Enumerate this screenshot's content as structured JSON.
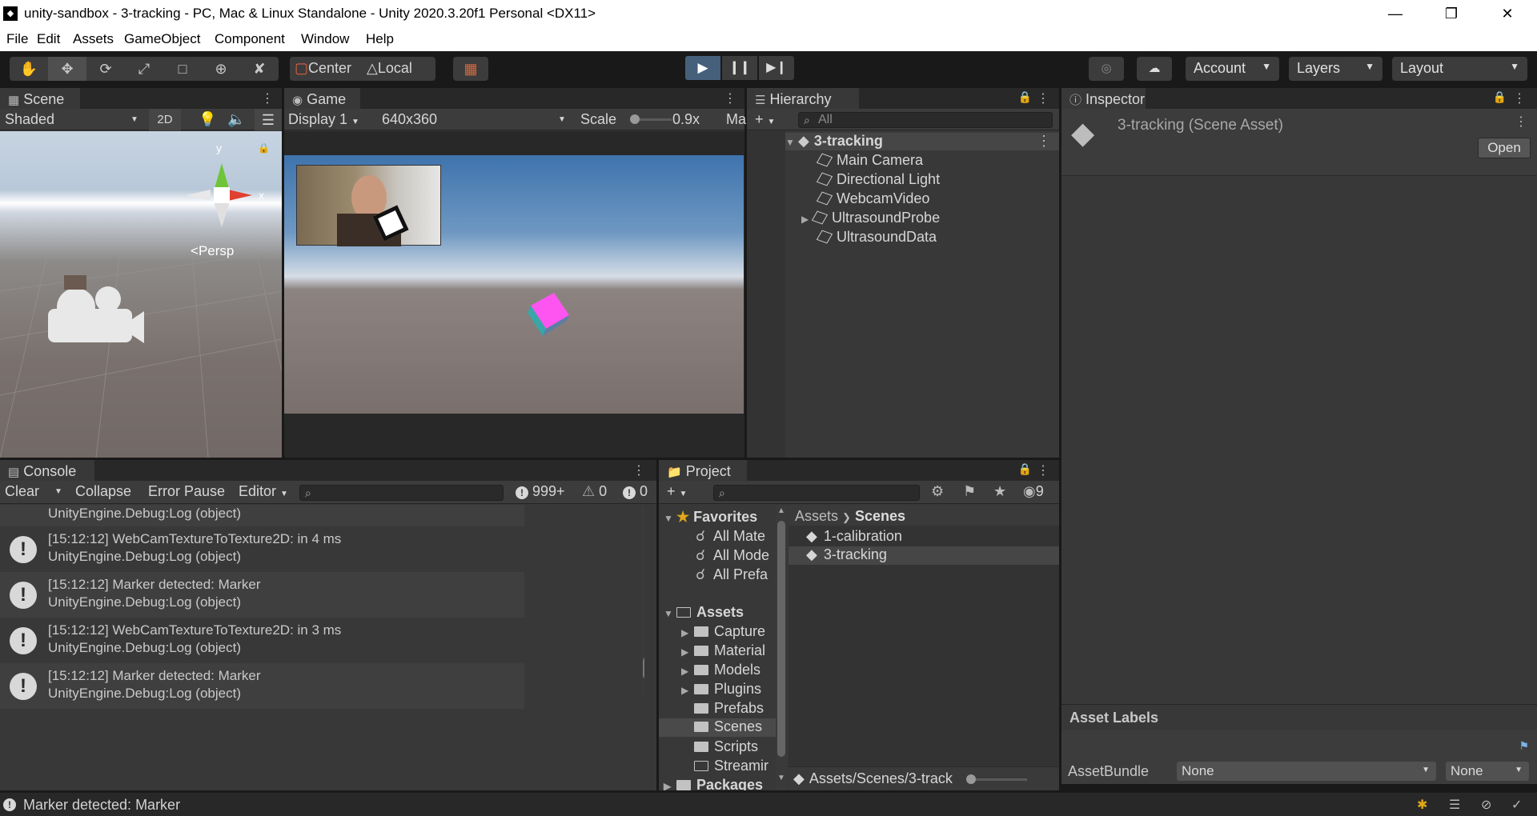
{
  "window": {
    "title": "unity-sandbox - 3-tracking - PC, Mac & Linux Standalone - Unity 2020.3.20f1 Personal <DX11>",
    "minimize": "—",
    "maximize": "❐",
    "close": "✕"
  },
  "menu": [
    "File",
    "Edit",
    "Assets",
    "GameObject",
    "Component",
    "Window",
    "Help"
  ],
  "toolbar": {
    "pivot": "Center",
    "space": "Local",
    "account": "Account",
    "layers": "Layers",
    "layout": "Layout"
  },
  "scene": {
    "tab": "Scene",
    "shading": "Shaded",
    "mode2d": "2D",
    "persp": "Persp",
    "axis_y": "y",
    "axis_x": "x"
  },
  "game": {
    "tab": "Game",
    "display": "Display 1",
    "resolution": "640x360",
    "scale_label": "Scale",
    "scale_value": "0.9x",
    "maximize": "Ma"
  },
  "hierarchy": {
    "tab": "Hierarchy",
    "search_placeholder": "All",
    "scene": "3-tracking",
    "items": [
      "Main Camera",
      "Directional Light",
      "WebcamVideo",
      "UltrasoundProbe",
      "UltrasoundData"
    ]
  },
  "inspector": {
    "tab": "Inspector",
    "title": "3-tracking (Scene Asset)",
    "open": "Open",
    "asset_labels": "Asset Labels",
    "assetbundle_label": "AssetBundle",
    "assetbundle_value": "None",
    "variant_value": "None"
  },
  "console": {
    "tab": "Console",
    "clear": "Clear",
    "collapse": "Collapse",
    "error_pause": "Error Pause",
    "editor": "Editor",
    "log_count": "999+",
    "warn_count": "0",
    "error_count": "0",
    "partial_top": "UnityEngine.Debug:Log (object)",
    "entries": [
      {
        "line1": "[15:12:12] WebCamTextureToTexture2D: in 4 ms",
        "line2": "UnityEngine.Debug:Log (object)"
      },
      {
        "line1": "[15:12:12] Marker detected: Marker",
        "line2": "UnityEngine.Debug:Log (object)"
      },
      {
        "line1": "[15:12:12] WebCamTextureToTexture2D: in 3 ms",
        "line2": "UnityEngine.Debug:Log (object)"
      },
      {
        "line1": "[15:12:12] Marker detected: Marker",
        "line2": "UnityEngine.Debug:Log (object)"
      }
    ]
  },
  "project": {
    "tab": "Project",
    "hidden_count": "9",
    "favorites": "Favorites",
    "fav_items": [
      "All Mate",
      "All Mode",
      "All Prefa"
    ],
    "assets": "Assets",
    "folders": [
      "Capture",
      "Material",
      "Models",
      "Plugins",
      "Prefabs",
      "Scenes",
      "Scripts",
      "Streamir"
    ],
    "packages": "Packages",
    "breadcrumb_root": "Assets",
    "breadcrumb_current": "Scenes",
    "files": [
      "1-calibration",
      "3-tracking"
    ],
    "footer_path": "Assets/Scenes/3-track"
  },
  "status": {
    "message": "Marker detected: Marker"
  }
}
